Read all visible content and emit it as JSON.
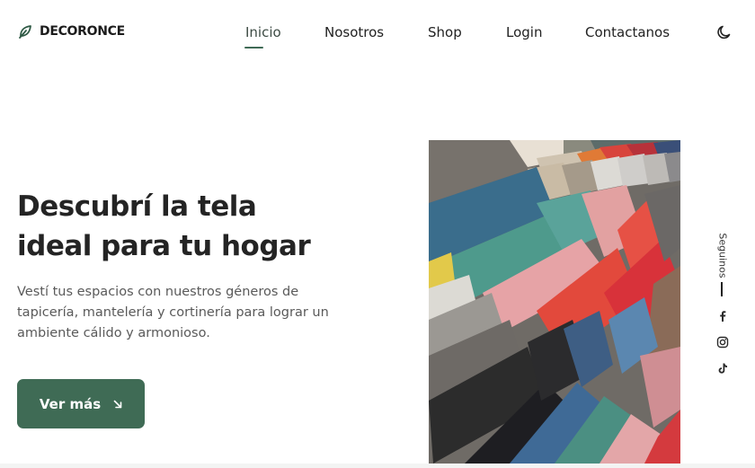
{
  "brand": {
    "name": "DECORONCE",
    "logo_icon": "leaf-icon",
    "accent_color": "#3f6b55"
  },
  "nav": {
    "items": [
      {
        "label": "Inicio",
        "active": true
      },
      {
        "label": "Nosotros",
        "active": false
      },
      {
        "label": "Shop",
        "active": false
      },
      {
        "label": "Login",
        "active": false
      },
      {
        "label": "Contactanos",
        "active": false
      }
    ],
    "theme_toggle_icon": "moon-icon"
  },
  "hero": {
    "title_line1": "Descubrí la tela",
    "title_line2": "ideal para tu hogar",
    "description": "Vestí tus espacios con nuestros géneros de tapicería, mantelería y cortinería para lograr un ambiente cálido y armonioso.",
    "cta_label": "Ver más",
    "cta_icon": "arrow-down-right-icon",
    "image_subject": "fabric-swatches"
  },
  "social": {
    "label": "Seguinos",
    "icons": [
      "facebook-icon",
      "instagram-icon",
      "tiktok-icon"
    ]
  }
}
